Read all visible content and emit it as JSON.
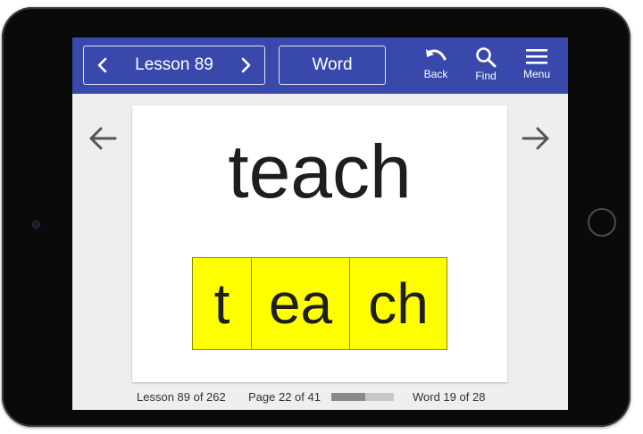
{
  "header": {
    "lesson_title": "Lesson 89",
    "mode_label": "Word",
    "tools": {
      "back_label": "Back",
      "find_label": "Find",
      "menu_label": "Menu"
    }
  },
  "card": {
    "word": "teach",
    "segments": [
      "t",
      "ea",
      "ch"
    ],
    "segment_color": "#ffff00"
  },
  "footer": {
    "lesson_status": "Lesson 89 of 262",
    "page_status": "Page 22 of 41",
    "progress_fraction": 0.54,
    "word_status": "Word 19 of 28"
  },
  "colors": {
    "app_bar": "#3949ab",
    "screen_background": "#eeeeee"
  },
  "icons": {
    "prev_lesson": "chevron-left-icon",
    "next_lesson": "chevron-right-icon",
    "back": "undo-icon",
    "find": "search-icon",
    "menu": "hamburger-icon",
    "prev_word": "arrow-left-icon",
    "next_word": "arrow-right-icon"
  }
}
